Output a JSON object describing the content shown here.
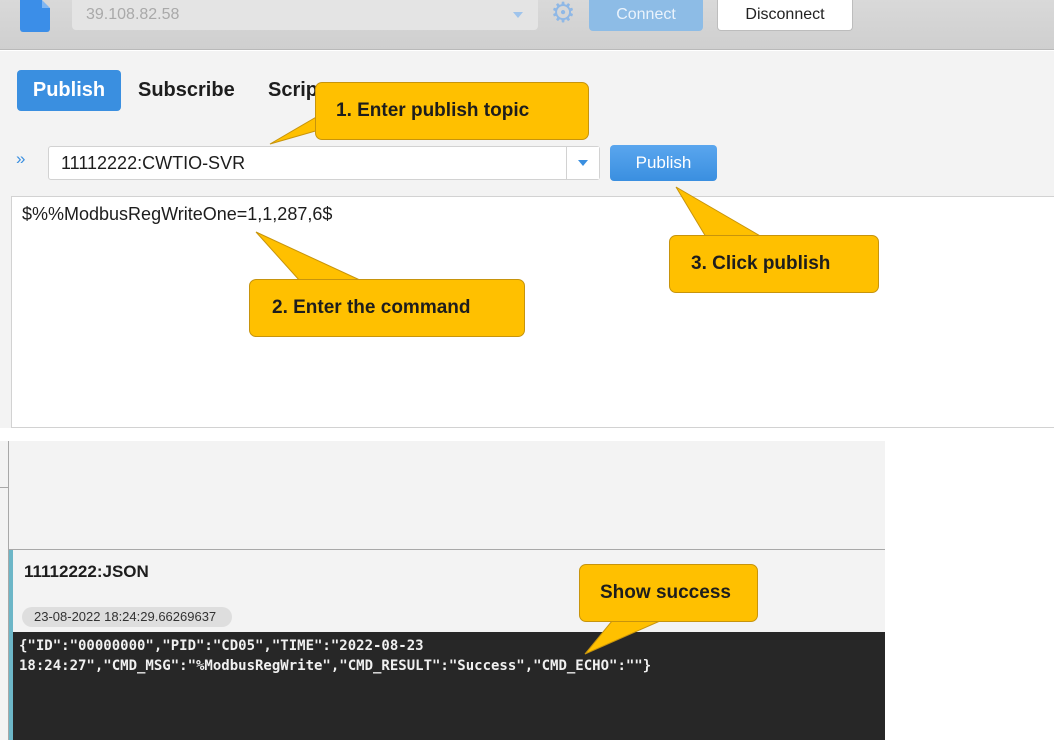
{
  "toolbar": {
    "broker": "39.108.82.58",
    "connect_label": "Connect",
    "disconnect_label": "Disconnect"
  },
  "tabs": [
    {
      "label": "Publish"
    },
    {
      "label": "Subscribe"
    },
    {
      "label": "Scrip"
    }
  ],
  "publish": {
    "topic": "11112222:CWTIO-SVR",
    "button_label": "Publish",
    "payload": "$%%ModbusRegWriteOne=1,1,287,6$"
  },
  "message": {
    "topic": "11112222:JSON",
    "timestamp": "23-08-2022  18:24:29.66269637",
    "payload_line1": "{\"ID\":\"00000000\",\"PID\":\"CD05\",\"TIME\":\"2022-08-23",
    "payload_line2": "18:24:27\",\"CMD_MSG\":\"%ModbusRegWrite\",\"CMD_RESULT\":\"Success\",\"CMD_ECHO\":\"\"}"
  },
  "callouts": {
    "step1": "1.    Enter publish topic",
    "step2": "2.    Enter the command",
    "step3": "3.    Click publish",
    "success": "Show success"
  },
  "colors": {
    "accent": "#3a8fe0",
    "callout": "#ffc000",
    "payload_bg": "#272727"
  }
}
